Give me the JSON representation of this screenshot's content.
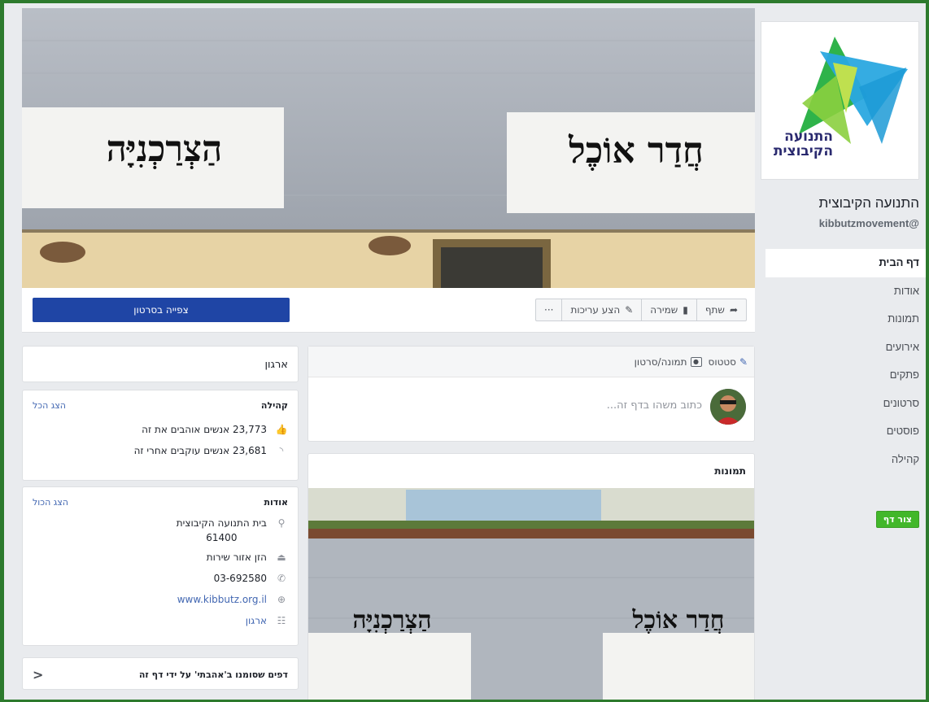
{
  "sidebar": {
    "logo_text_1": "התנועה",
    "logo_text_2": "הקיבוצית",
    "page_name": "התנועה הקיבוצית",
    "page_handle": "kibbutzmovement@",
    "nav": [
      {
        "label": "דף הבית",
        "active": true
      },
      {
        "label": "אודות"
      },
      {
        "label": "תמונות"
      },
      {
        "label": "אירועים"
      },
      {
        "label": "פתקים"
      },
      {
        "label": "סרטונים"
      },
      {
        "label": "פוסטים"
      },
      {
        "label": "קהילה"
      }
    ],
    "create_page": "צור דף"
  },
  "cover": {
    "sign_left": "הַצְרַכְנִיָּה",
    "sign_right": "חֲדַר אוֹכֶל"
  },
  "actions": {
    "watch_video": "צפייה בסרטון",
    "share": "שתף",
    "save": "שמירה",
    "suggest_edits": "הצע עריכות",
    "more": "···"
  },
  "composer": {
    "status": "סטטוס",
    "photo_video": "תמונה/סרטון",
    "placeholder": "כתוב משהו בדף זה..."
  },
  "photos": {
    "title": "תמונות"
  },
  "left": {
    "category": "ארגון",
    "community": {
      "title": "קהילה",
      "see_all": "הצג הכל",
      "likes": "23,773 אנשים אוהבים את זה",
      "follows": "23,681 אנשים עוקבים אחרי זה"
    },
    "about": {
      "title": "אודות",
      "see_all": "הצג הכול",
      "address_1": "בית התנועה הקיבוצית",
      "address_2": "61400",
      "service_area": "הזן אזור שירות",
      "phone": "03-692580",
      "website": "www.kibbutz.org.il",
      "category": "ארגון"
    },
    "liked_pages": "דפים שסומנו ב'אהבתי' על ידי דף זה",
    "liked_chevron": "<"
  }
}
